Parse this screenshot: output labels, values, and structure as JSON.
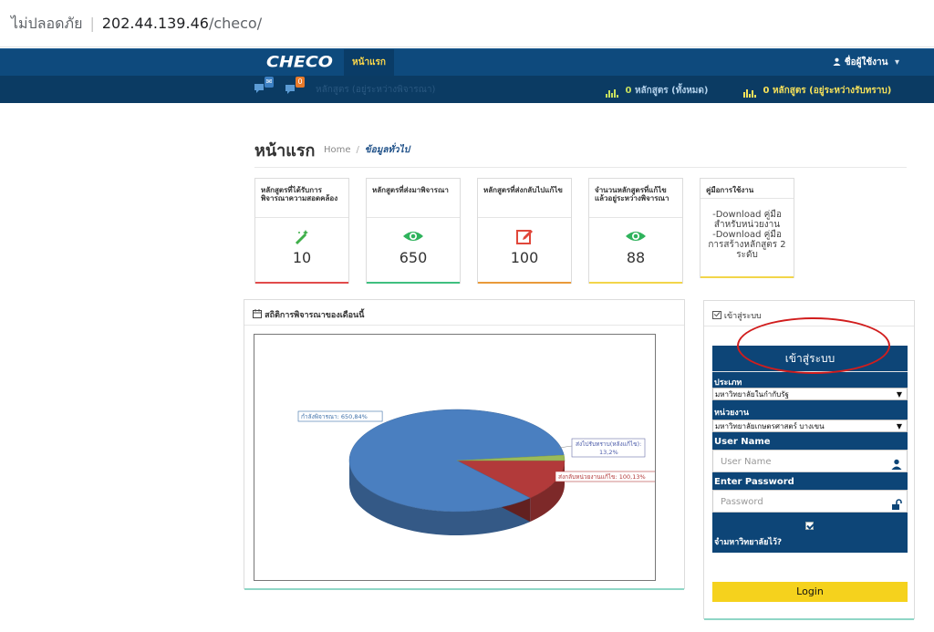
{
  "browser": {
    "security_label": "ไม่ปลอดภัย",
    "separator": "|",
    "host": "202.44.139.46",
    "path": "/checo/"
  },
  "navbar": {
    "brand": "CHECO",
    "active_tab": "หน้าแรก",
    "user_menu": "ชื่อผู้ใช้งาน",
    "user_icon": "user-icon",
    "caret": "▾"
  },
  "subbar": {
    "badge_1": "0",
    "faint_text": "หลักสูตร (อยู่ระหว่างพิจารณา)",
    "stat_all_value": "0",
    "stat_all_label": "หลักสูตร (ทั้งหมด)",
    "stat_pending_value": "0",
    "stat_pending_label": "หลักสูตร (อยู่ระหว่างรับทราบ)",
    "colors": {
      "green": "#c7e05f",
      "yellow": "#f6e15a"
    }
  },
  "page": {
    "title": "หน้าแรก",
    "breadcrumb_home": "Home",
    "breadcrumb_sep": "/",
    "breadcrumb_current": "ข้อมูลทั่วไป"
  },
  "cards": [
    {
      "title": "หลักสูตรที่ได้รับการพิจารณาความสอดคล้อง",
      "icon": "magic-wand-icon",
      "value": "10",
      "color": "#e14b4b"
    },
    {
      "title": "หลักสูตรที่ส่งมาพิจารณา",
      "icon": "eye-icon",
      "value": "650",
      "color": "#3fbf7f"
    },
    {
      "title": "หลักสูตรที่ส่งกลับไปแก้ไข",
      "icon": "edit-icon",
      "value": "100",
      "color": "#e99a3a"
    },
    {
      "title": "จำนวนหลักสูตรที่แก้ไขแล้วอยู่ระหว่างพิจารณา",
      "icon": "eye-icon",
      "value": "88",
      "color": "#f2d54a"
    }
  ],
  "manual_card": {
    "title": "คู่มือการใช้งาน",
    "line1": "-Download คู่มือสำหรับหน่วยงาน",
    "line2": "-Download คู่มือการสร้างหลักสูตร 2 ระดับ"
  },
  "chart_panel": {
    "title": "สถิติการพิจารณาของเดือนนี้",
    "icon": "calendar-icon"
  },
  "chart_data": {
    "type": "pie",
    "slices": [
      {
        "label": "กำลังพิจารณา: 650,84%",
        "value": 650,
        "percent": 84,
        "color": "#4a7fc0"
      },
      {
        "label": "ส่งกลับหน่วยงานแก้ไข: 100,13%",
        "value": 100,
        "percent": 13,
        "color": "#b23a3a"
      },
      {
        "label": "ส่งไปรับทราบ(หลังแก้ไข): 13,2%",
        "value": 13,
        "percent": 2,
        "color": "#9bbb59"
      }
    ]
  },
  "login_panel": {
    "header": "เข้าสู่ระบบ",
    "header_icon": "login-icon",
    "box_title": "เข้าสู่ระบบ",
    "type_label": "ประเภท",
    "type_value": "มหาวิทยาลัยในกำกับรัฐ",
    "unit_label": "หน่วยงาน",
    "unit_value": "มหาวิทยาลัยเกษตรศาสตร์ บางเขน",
    "username_label": "User Name",
    "username_placeholder": "User Name",
    "password_label": "Enter Password",
    "password_placeholder": "Password",
    "remember_label": "จำมหาวิทยาลัยไว้?",
    "login_button": "Login",
    "arrow": "▼"
  }
}
